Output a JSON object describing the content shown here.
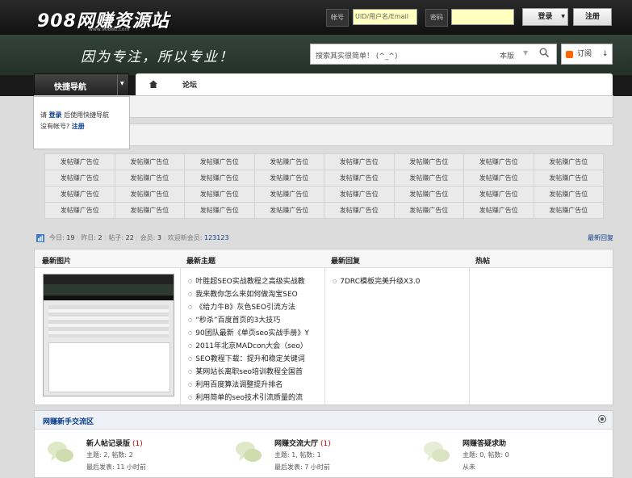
{
  "header": {
    "logo": "908网赚资源站",
    "logo_sub": "www.908wz.com",
    "account_label": "帐号",
    "account_placeholder": "UID/用户名/Email",
    "password_label": "密码",
    "login_button": "登录",
    "register_button": "注册"
  },
  "banner": {
    "slogan": "因为专注，所以专业！",
    "search_placeholder": "搜索其实很简单！ (^_^)",
    "search_scope": "本版",
    "subscribe_label": "订阅"
  },
  "nav": {
    "quick_nav_label": "快捷导航",
    "tab_forum": "论坛",
    "panel": {
      "please": "请",
      "login_link": "登录",
      "after_login": "后使用快捷导航",
      "no_account": "没有帐号?",
      "register_link": "注册"
    }
  },
  "ads": {
    "cell_text": "发帖赚广告位",
    "rows": [
      [
        "发帖赚广告位",
        "发帖赚广告位",
        "发帖赚广告位",
        "发帖赚广告位",
        "发帖赚广告位",
        "发帖赚广告位",
        "发帖赚广告位",
        "发帖赚广告位"
      ],
      [
        "发帖赚广告位",
        "发帖赚广告位",
        "发帖赚广告位",
        "发帖赚广告位",
        "发帖赚广告位",
        "发帖赚广告位",
        "发帖赚广告位",
        "发帖赚广告位"
      ],
      [
        "发帖赚广告位",
        "发帖赚广告位",
        "发帖赚广告位",
        "发帖赚广告位",
        "发帖赚广告位",
        "发帖赚广告位",
        "发帖赚广告位",
        "发帖赚广告位"
      ],
      [
        "发帖赚广告位",
        "发帖赚广告位",
        "发帖赚广告位",
        "发帖赚广告位",
        "发帖赚广告位",
        "发帖赚广告位",
        "发帖赚广告位",
        "发帖赚广告位"
      ]
    ]
  },
  "stats": {
    "today_label": "今日:",
    "today": "19",
    "yesterday_label": "昨日:",
    "yesterday": "2",
    "posts_label": "帖子:",
    "posts": "22",
    "members_label": "会员:",
    "members": "3",
    "welcome_label": "欢迎新会员:",
    "new_member": "123123",
    "latest_reply_link": "最新回复"
  },
  "latest": {
    "col_images": "最新图片",
    "col_topics": "最新主题",
    "col_replies": "最新回复",
    "col_hot": "热帖",
    "topics": [
      "叶胜超SEO实战教程之高级实战教",
      "我来教你怎么来如何做淘宝SEO",
      "《给力牛B》灰色SEO引流方法",
      "“秒杀”百度首页的3大技巧",
      "90团队最新《单页seo实战手册》Y",
      "2011年北京MADcon大会（seo）",
      "SEO教程下载：提升和稳定关键词",
      "某网站长离职seo培训教程全国首",
      "利用百度算法调整提升排名",
      "利用简单的seo技术引流质量的流"
    ],
    "replies": [
      "7DRC模板完美升级X3.0"
    ]
  },
  "zone": {
    "title": "网赚新手交流区",
    "forums": [
      {
        "name": "新人帖记录版",
        "new": "(1)",
        "stats": "主题: 2, 帖数: 2",
        "last": "最后发表: 11 小时前"
      },
      {
        "name": "网赚交流大厅",
        "new": "(1)",
        "stats": "主题: 1, 帖数: 1",
        "last": "最后发表: 7 小时前"
      },
      {
        "name": "网赚答疑求助",
        "new": "",
        "stats": "主题: 0, 帖数: 0",
        "last": "从未"
      }
    ]
  }
}
